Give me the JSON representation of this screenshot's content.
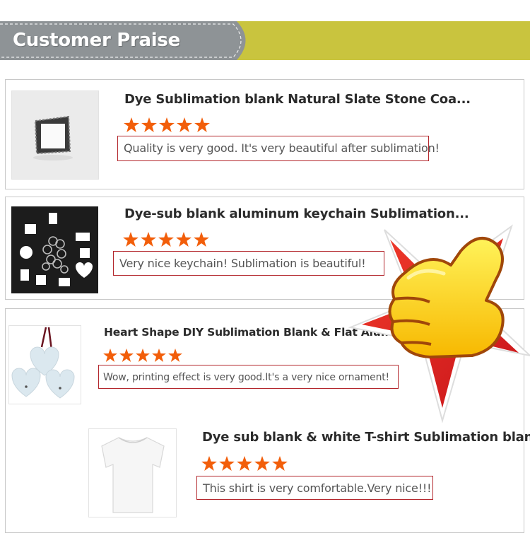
{
  "header": {
    "title": "Customer Praise"
  },
  "reviews": [
    {
      "title": "Dye Sublimation blank Natural Slate Stone Coa...",
      "rating": 5,
      "comment": "Quality is very good. It's very beautiful after sublimation!",
      "image": "slate-stone-coaster"
    },
    {
      "title": "Dye-sub blank aluminum keychain Sublimation...",
      "rating": 5,
      "comment": "Very nice keychain! Sublimation is beautiful!",
      "image": "aluminum-keychains"
    },
    {
      "title": "Heart Shape DIY Sublimation Blank & Flat Alu...",
      "rating": 5,
      "comment": "Wow, printing effect is very good.It's a very nice ornament!",
      "image": "heart-ornaments"
    },
    {
      "title": "Dye sub blank & white T-shirt Sublimation blan...",
      "rating": 5,
      "comment": "This shirt is very comfortable.Very nice!!!",
      "image": "white-tshirt"
    }
  ],
  "colors": {
    "header_band": "#c9c43e",
    "header_tab": "#8e9396",
    "star": "#f25e0a",
    "comment_border": "#b3262c",
    "badge_star": "#e8231e",
    "thumb_hand": "#ffd20a"
  },
  "badge": {
    "icon": "thumbs-up-icon"
  }
}
